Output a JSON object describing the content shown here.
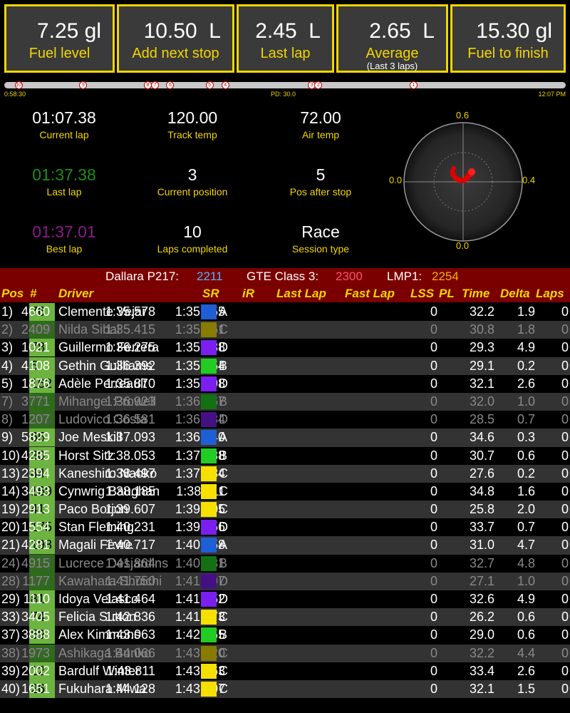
{
  "fuel": [
    {
      "value": "7.25 gl",
      "label": "Fuel level"
    },
    {
      "value": "10.50  L",
      "label": "Add next stop"
    },
    {
      "value": "2.45  L",
      "label": "Last lap"
    },
    {
      "value": "2.65  L",
      "label": "Average",
      "sub": "(Last 3 laps)"
    },
    {
      "value": "15.30 gl",
      "label": "Fuel to finish"
    }
  ],
  "timeline": {
    "start": "0:58:30",
    "pd": "PD: 30.0",
    "end": "12:07 PM",
    "markers": [
      {
        "n": "10",
        "pos": 0.025
      },
      {
        "n": "9",
        "pos": 0.14
      },
      {
        "n": "8",
        "pos": 0.255
      },
      {
        "n": "7",
        "pos": 0.268
      },
      {
        "n": "6",
        "pos": 0.295
      },
      {
        "n": "5",
        "pos": 0.365
      },
      {
        "n": "4",
        "pos": 0.393
      },
      {
        "n": "3",
        "pos": 0.547
      },
      {
        "n": "2",
        "pos": 0.559
      },
      {
        "n": "1",
        "pos": 0.728
      }
    ]
  },
  "stats": [
    {
      "value": "01:07.38",
      "label": "Current lap",
      "color": "#ffffff"
    },
    {
      "value": "120.00",
      "label": "Track temp",
      "color": "#ffffff"
    },
    {
      "value": "72.00",
      "label": "Air temp",
      "color": "#ffffff"
    },
    {
      "value": "01:37.38",
      "label": "Last lap",
      "color": "#1a8f1a"
    },
    {
      "value": "3",
      "label": "Current position",
      "color": "#ffffff"
    },
    {
      "value": "5",
      "label": "Pos after stop",
      "color": "#ffffff"
    },
    {
      "value": "01:37.01",
      "label": "Best lap",
      "color": "#8b1a8b"
    },
    {
      "value": "10",
      "label": "Laps completed",
      "color": "#ffffff"
    },
    {
      "value": "Race",
      "label": "Session type",
      "color": "#ffffff"
    }
  ],
  "radar": {
    "top": "0.6",
    "left": "0.0",
    "right": "0.4",
    "bottom": "0.0"
  },
  "classes": [
    {
      "name": "Dallara P217:",
      "sof": "2211",
      "color": "#4fb3ff"
    },
    {
      "name": "GTE Class 3:",
      "sof": "2300",
      "color": "#ff4f6a"
    },
    {
      "name": "LMP1:",
      "sof": "2254",
      "color": "#f2b400"
    }
  ],
  "columns": {
    "pos": "Pos",
    "num": "#",
    "driver": "Driver",
    "sr": "SR",
    "ir": "iR",
    "last": "Last Lap",
    "fast": "Fast Lap",
    "lss": "LSS",
    "pl": "PL",
    "time": "Time",
    "delta": "Delta",
    "laps": "Laps"
  },
  "sr_colors": {
    "A": "#1e5fd6",
    "B": "#22cc22",
    "C": "#f5e000",
    "D": "#7a1ff0"
  },
  "rows": [
    {
      "pos": "1)",
      "num": "76",
      "driver": "Clemente Vejar",
      "lic": "A",
      "ir": "4660",
      "last": "1:35.578",
      "fast": "1:35.055",
      "lss": "0",
      "time": "32.2",
      "delta": "1.9",
      "laps": "0",
      "faded": false
    },
    {
      "pos": "2)",
      "num": "189",
      "driver": "Nilda Sibal",
      "lic": "C",
      "ir": "2409",
      "last": "1:35.415",
      "fast": "1:35.261",
      "lss": "0",
      "time": "30.8",
      "delta": "1.8",
      "laps": "0",
      "faded": true
    },
    {
      "pos": "3)",
      "num": "78",
      "driver": "Guillermo Ferrera",
      "lic": "D",
      "ir": "1021",
      "last": "1:36.275",
      "fast": "1:35.438",
      "lss": "0",
      "time": "29.3",
      "delta": "4.9",
      "laps": "0",
      "faded": false
    },
    {
      "pos": "4)",
      "num": "5",
      "driver": "Gethin Guilliams",
      "lic": "B",
      "ir": "4108",
      "last": "1:36.392",
      "fast": "1:35.454",
      "lss": "0",
      "time": "29.1",
      "delta": "0.2",
      "laps": "0",
      "faded": false
    },
    {
      "pos": "5)",
      "num": "162",
      "driver": "Adèle Perreault",
      "lic": "D",
      "ir": "1876",
      "last": "1:35.870",
      "fast": "1:35.698",
      "lss": "0",
      "time": "32.1",
      "delta": "2.6",
      "laps": "0",
      "faded": false
    },
    {
      "pos": "7)",
      "num": "72",
      "driver": "Mihangel Prowell",
      "lic": "B",
      "ir": "3771",
      "last": "1:36.923",
      "fast": "1:36.467",
      "lss": "0",
      "time": "32.0",
      "delta": "1.0",
      "laps": "0",
      "faded": true
    },
    {
      "pos": "8)",
      "num": "135",
      "driver": "Ludovico Costa",
      "lic": "D",
      "ir": "1207",
      "last": "1:36.581",
      "fast": "1:36.484",
      "lss": "0",
      "time": "28.5",
      "delta": "0.7",
      "laps": "0",
      "faded": true
    },
    {
      "pos": "9)",
      "num": "65",
      "driver": "Joe Meskill",
      "lic": "A",
      "ir": "5829",
      "last": "1:37.093",
      "fast": "1:36.940",
      "lss": "0",
      "time": "34.6",
      "delta": "0.3",
      "laps": "0",
      "faded": false
    },
    {
      "pos": "10)",
      "num": "30",
      "driver": "Horst Sitz",
      "lic": "B",
      "ir": "4285",
      "last": "1:38.053",
      "fast": "1:37.188",
      "lss": "0",
      "time": "30.7",
      "delta": "0.6",
      "laps": "0",
      "faded": false
    },
    {
      "pos": "13)",
      "num": "44",
      "driver": "Kaneshiro Naoko",
      "lic": "C",
      "ir": "2394",
      "last": "1:38.497",
      "fast": "1:37.584",
      "lss": "0",
      "time": "27.6",
      "delta": "0.2",
      "laps": "0",
      "faded": false
    },
    {
      "pos": "14)",
      "num": "169",
      "driver": "Cynwrig Baughan",
      "lic": "C",
      "ir": "3493",
      "last": "1:38.185",
      "fast": "1:38.011",
      "lss": "0",
      "time": "34.8",
      "delta": "1.6",
      "laps": "0",
      "faded": false
    },
    {
      "pos": "19)",
      "num": "41",
      "driver": "Paco Borjon",
      "lic": "C",
      "ir": "2913",
      "last": "1:39.607",
      "fast": "1:39.305",
      "lss": "0",
      "time": "25.8",
      "delta": "2.0",
      "laps": "0",
      "faded": false
    },
    {
      "pos": "20)",
      "num": "175",
      "driver": "Stan Fleming",
      "lic": "D",
      "ir": "1554",
      "last": "1:40.231",
      "fast": "1:39.756",
      "lss": "0",
      "time": "33.7",
      "delta": "0.7",
      "laps": "0",
      "faded": false
    },
    {
      "pos": "21)",
      "num": "198",
      "driver": "Magali Fèvre",
      "lic": "A",
      "ir": "4281",
      "last": "1:40.717",
      "fast": "1:40.058",
      "lss": "0",
      "time": "31.0",
      "delta": "4.7",
      "laps": "0",
      "faded": false
    },
    {
      "pos": "24)",
      "num": "182",
      "driver": "Lucrece Desjardins",
      "lic": "B",
      "ir": "4915",
      "last": "1:41.864",
      "fast": "1:40.881",
      "lss": "0",
      "time": "32.7",
      "delta": "4.8",
      "laps": "0",
      "faded": true
    },
    {
      "pos": "28)",
      "num": "10",
      "driver": "Kawahara Shuichi",
      "lic": "D",
      "ir": "1177",
      "last": "1:41.750",
      "fast": "1:41.297",
      "lss": "0",
      "time": "27.1",
      "delta": "1.0",
      "laps": "0",
      "faded": true
    },
    {
      "pos": "29)",
      "num": "81",
      "driver": "Idoya Velasco",
      "lic": "D",
      "ir": "1110",
      "last": "1:41.464",
      "fast": "1:41.352",
      "lss": "0",
      "time": "32.6",
      "delta": "4.9",
      "laps": "0",
      "faded": false
    },
    {
      "pos": "33)",
      "num": "74",
      "driver": "Felicia Sutton",
      "lic": "C",
      "ir": "3405",
      "last": "1:42.836",
      "fast": "1:41.873",
      "lss": "0",
      "time": "26.2",
      "delta": "0.6",
      "laps": "0",
      "faded": false
    },
    {
      "pos": "37)",
      "num": "59",
      "driver": "Alex Kimmons",
      "lic": "B",
      "ir": "3888",
      "last": "1:43.063",
      "fast": "1:42.855",
      "lss": "0",
      "time": "29.0",
      "delta": "0.6",
      "laps": "0",
      "faded": false
    },
    {
      "pos": "38)",
      "num": "37",
      "driver": "Ashikaga Bunko",
      "lic": "C",
      "ir": "1973",
      "last": "1:44.066",
      "fast": "1:43.120",
      "lss": "0",
      "time": "32.2",
      "delta": "4.4",
      "laps": "0",
      "faded": true
    },
    {
      "pos": "39)",
      "num": "12",
      "driver": "Bardulf Winter",
      "lic": "C",
      "ir": "2002",
      "last": "1:43.811",
      "fast": "1:43.163",
      "lss": "0",
      "time": "33.4",
      "delta": "2.6",
      "laps": "0",
      "faded": false
    },
    {
      "pos": "40)",
      "num": "26",
      "driver": "Fukuhara Miwa",
      "lic": "C",
      "ir": "1651",
      "last": "1:44.128",
      "fast": "1:43.407",
      "lss": "0",
      "time": "32.1",
      "delta": "1.5",
      "laps": "0",
      "faded": false
    }
  ]
}
